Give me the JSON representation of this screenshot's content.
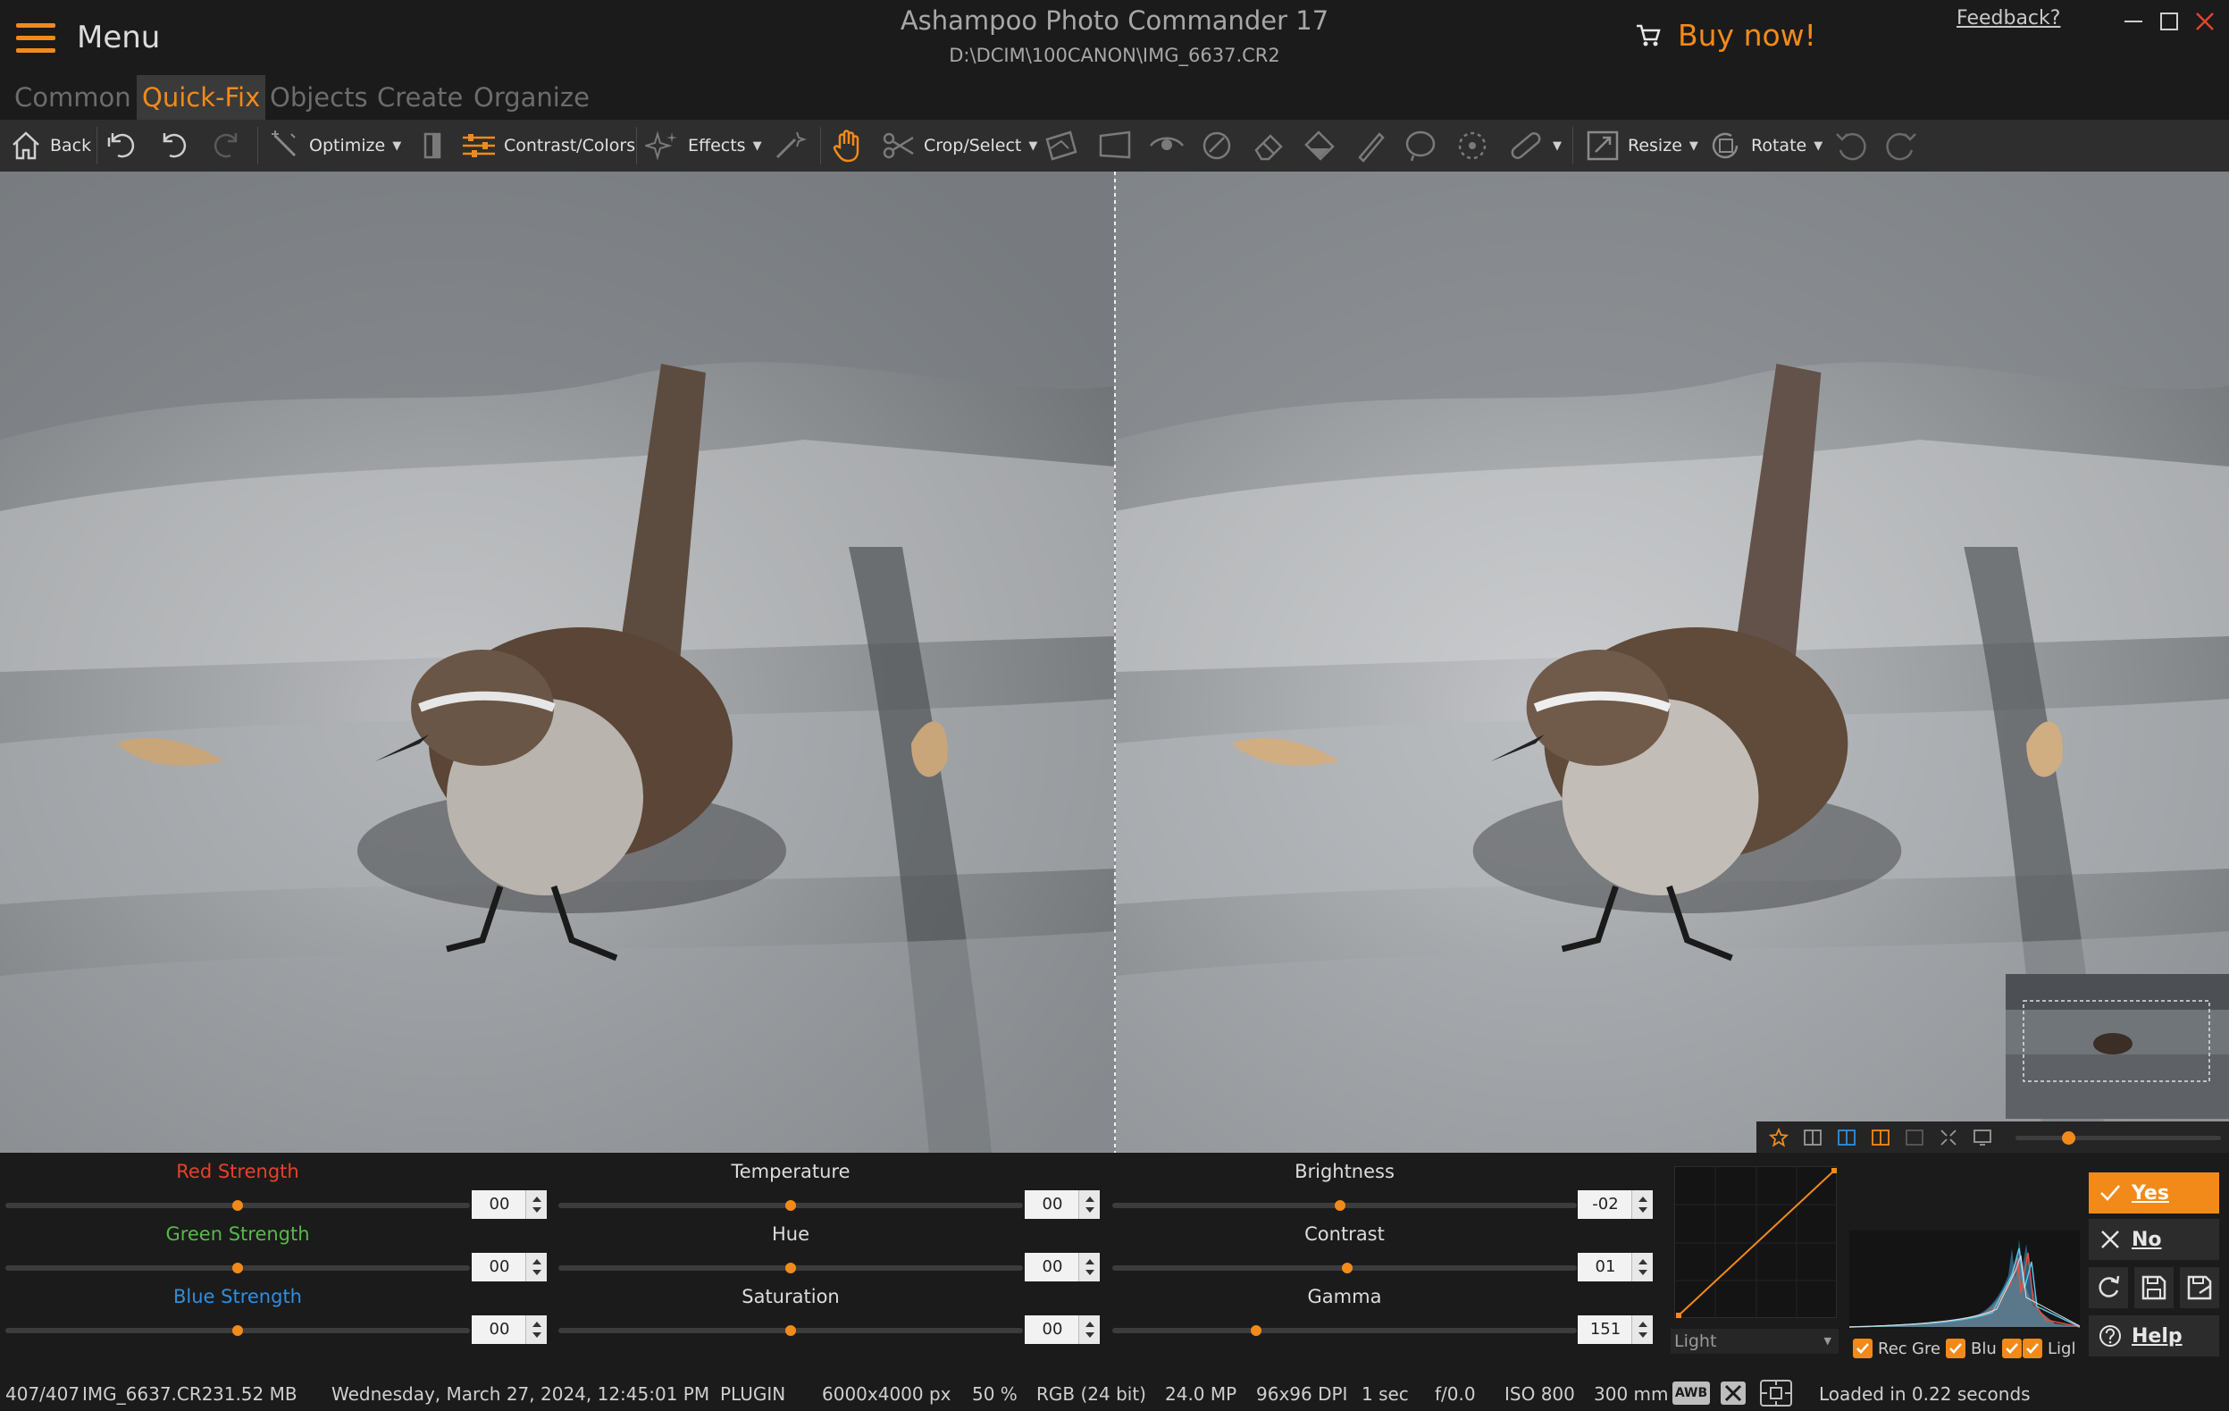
{
  "titlebar": {
    "menu_label": "Menu",
    "app_title": "Ashampoo Photo Commander 17",
    "file_path": "D:\\DCIM\\100CANON\\IMG_6637.CR2",
    "buy_label": "Buy now!",
    "feedback_label": "Feedback?"
  },
  "tabs": [
    {
      "label": "Common",
      "active": false
    },
    {
      "label": "Quick-Fix",
      "active": true
    },
    {
      "label": "Objects",
      "active": false
    },
    {
      "label": "Create",
      "active": false
    },
    {
      "label": "Organize",
      "active": false
    }
  ],
  "toolbar": {
    "back_label": "Back",
    "optimize_label": "Optimize",
    "contrast_label": "Contrast/Colors",
    "effects_label": "Effects",
    "crop_label": "Crop/Select",
    "resize_label": "Resize",
    "rotate_label": "Rotate"
  },
  "adjustments": {
    "red": {
      "label": "Red Strength",
      "value": "00",
      "level": 0.5
    },
    "green": {
      "label": "Green Strength",
      "value": "00",
      "level": 0.5
    },
    "blue": {
      "label": "Blue Strength",
      "value": "00",
      "level": 0.5
    },
    "temperature": {
      "label": "Temperature",
      "value": "00",
      "level": 0.5
    },
    "hue": {
      "label": "Hue",
      "value": "00",
      "level": 0.5
    },
    "saturation": {
      "label": "Saturation",
      "value": "00",
      "level": 0.5
    },
    "brightness": {
      "label": "Brightness",
      "value": "-02",
      "level": 0.49
    },
    "contrast": {
      "label": "Contrast",
      "value": "01",
      "level": 0.505
    },
    "gamma": {
      "label": "Gamma",
      "value": "151",
      "level": 0.31
    }
  },
  "curve": {
    "channel": "Light"
  },
  "histogram_checks": [
    "Rec",
    "Gre",
    "Blu",
    "Ligl"
  ],
  "actions": {
    "yes_label": "Yes",
    "no_label": "No",
    "help_label": "Help"
  },
  "statusbar": {
    "index": "407/407",
    "filename": "IMG_6637.CR2",
    "filesize": "31.52 MB",
    "datetime": "Wednesday, March 27, 2024, 12:45:01 PM",
    "source": "PLUGIN",
    "dimensions": "6000x4000 px",
    "zoom": "50 %",
    "color_mode": "RGB (24 bit)",
    "megapixels": "24.0 MP",
    "dpi": "96x96 DPI",
    "exposure": "1 sec",
    "aperture": "f/0.0",
    "iso": "ISO 800",
    "focal": "300 mm",
    "wb_badge": "AWB",
    "load_time": "Loaded in 0.22 seconds"
  },
  "colors": {
    "accent": "#f28a1a",
    "red_label": "#e8402c",
    "green_label": "#58b84a",
    "blue_label": "#2e8fe0"
  }
}
